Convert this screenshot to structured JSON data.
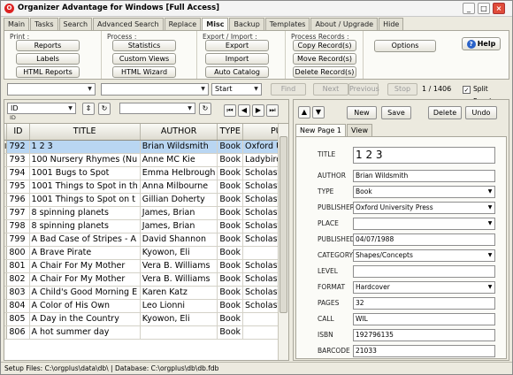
{
  "window": {
    "title": "Organizer Advantage for Windows [Full Access]"
  },
  "tabs": [
    "Main",
    "Tasks",
    "Search",
    "Advanced Search",
    "Replace",
    "Misc",
    "Backup",
    "Templates",
    "About / Upgrade",
    "Hide"
  ],
  "ribbon": {
    "print": {
      "label": "Print :",
      "buttons": [
        "Reports",
        "Labels",
        "HTML Reports"
      ]
    },
    "process": {
      "label": "Process :",
      "buttons": [
        "Statistics",
        "Custom Views",
        "HTML Wizard"
      ]
    },
    "export_import": {
      "label": "Export / Import :",
      "buttons": [
        "Export",
        "Import",
        "Auto Catalog"
      ]
    },
    "process_records": {
      "label": "Process Records :",
      "buttons": [
        "Copy Record(s)",
        "Move Record(s)",
        "Delete Record(s)"
      ]
    },
    "options": "Options",
    "help": "Help"
  },
  "searchbar": {
    "start": "Start",
    "find": "Find",
    "next": "Next",
    "previous": "Previous",
    "stop": "Stop",
    "counter": "1 / 1406",
    "split_panels": "Split Panels"
  },
  "grid_toolbar": {
    "field": "ID",
    "field_sub": "ID"
  },
  "grid": {
    "columns": [
      "ID",
      "TITLE",
      "AUTHOR",
      "TYPE",
      "PUBLISHER"
    ],
    "rows": [
      [
        "792",
        "1 2 3",
        "Brian Wildsmith",
        "Book",
        "Oxford University Press"
      ],
      [
        "793",
        "100 Nursery Rhymes (Nu",
        "Anne MC Kie",
        "Book",
        "Ladybird"
      ],
      [
        "794",
        "1001 Bugs to Spot",
        "Emma Helbrough",
        "Book",
        "Scholastic"
      ],
      [
        "795",
        "1001 Things to Spot in th",
        "Anna Milbourne",
        "Book",
        "Scholastic"
      ],
      [
        "796",
        "1001 Things to Spot on t",
        "Gillian Doherty",
        "Book",
        "Scholastic"
      ],
      [
        "797",
        "8 spinning planets",
        "James, Brian",
        "Book",
        "Scholastic"
      ],
      [
        "798",
        "8 spinning planets",
        "James, Brian",
        "Book",
        "Scholastic"
      ],
      [
        "799",
        "A Bad Case of Stripes - A",
        "David Shannon",
        "Book",
        "Scholastic"
      ],
      [
        "800",
        "A Brave Pirate",
        "Kyowon, Eli",
        "Book",
        ""
      ],
      [
        "801",
        "A Chair For My Mother",
        "Vera B. Williams",
        "Book",
        "Scholastic"
      ],
      [
        "802",
        "A Chair For My Mother",
        "Vera B. Williams",
        "Book",
        "Scholastic"
      ],
      [
        "803",
        "A Child's Good Morning E",
        "Karen Katz",
        "Book",
        "Scholastic"
      ],
      [
        "804",
        "A Color of His Own",
        "Leo Lionni",
        "Book",
        "Scholastic"
      ],
      [
        "805",
        "A Day in the Country",
        "Kyowon, Eli",
        "Book",
        ""
      ],
      [
        "806",
        "A hot summer day",
        "",
        "Book",
        ""
      ]
    ]
  },
  "record_buttons": {
    "new": "New",
    "save": "Save",
    "delete": "Delete",
    "undo": "Undo"
  },
  "record_tabs": [
    "New Page 1",
    "View"
  ],
  "record": {
    "title": {
      "label": "TITLE",
      "value": "1 2 3"
    },
    "author": {
      "label": "AUTHOR",
      "value": "Brian Wildsmith"
    },
    "type": {
      "label": "TYPE",
      "value": "Book"
    },
    "publisher": {
      "label": "PUBLISHER",
      "value": "Oxford University Press"
    },
    "place": {
      "label": "PLACE",
      "value": ""
    },
    "published": {
      "label": "PUBLISHED",
      "value": "04/07/1988"
    },
    "category": {
      "label": "CATEGORY",
      "value": "Shapes/Concepts"
    },
    "level": {
      "label": "LEVEL",
      "value": ""
    },
    "format": {
      "label": "FORMAT",
      "value": "Hardcover"
    },
    "pages": {
      "label": "PAGES",
      "value": "32"
    },
    "call": {
      "label": "CALL",
      "value": "WIL"
    },
    "isbn": {
      "label": "ISBN",
      "value": "192796135"
    },
    "barcode": {
      "label": "BARCODE",
      "value": "21033"
    }
  },
  "status": "Setup Files: C:\\orgplus\\data\\db\\ | Database: C:\\orgplus\\db\\db.fdb",
  "colors": {
    "selected_row": "#b9d6f2",
    "window_bg": "#eceadf",
    "close_button": "#e04b3a"
  }
}
